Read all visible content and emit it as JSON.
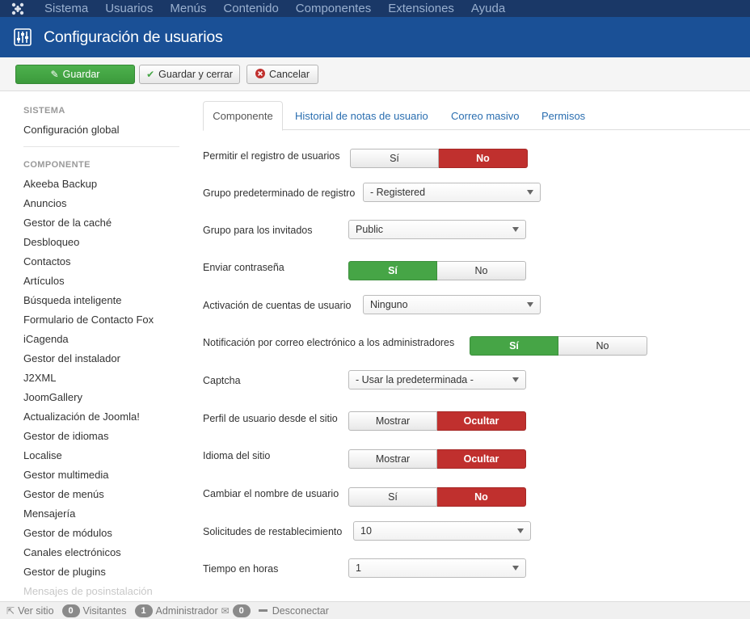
{
  "topnav": {
    "logo_icon": "joomla-logo-icon",
    "items": [
      "Sistema",
      "Usuarios",
      "Menús",
      "Contenido",
      "Componentes",
      "Extensiones",
      "Ayuda"
    ]
  },
  "header": {
    "icon": "sliders-icon",
    "title": "Configuración de usuarios"
  },
  "toolbar": {
    "save_label": "Guardar",
    "save_close_label": "Guardar y cerrar",
    "cancel_label": "Cancelar"
  },
  "sidebar": {
    "system_heading": "SISTEMA",
    "global_config": "Configuración global",
    "component_heading": "COMPONENTE",
    "items": [
      "Akeeba Backup",
      "Anuncios",
      "Gestor de la caché",
      "Desbloqueo",
      "Contactos",
      "Artículos",
      "Búsqueda inteligente",
      "Formulario de Contacto Fox",
      "iCagenda",
      "Gestor del instalador",
      "J2XML",
      "JoomGallery",
      "Actualización de Joomla!",
      "Gestor de idiomas",
      "Localise",
      "Gestor multimedia",
      "Gestor de menús",
      "Mensajería",
      "Gestor de módulos",
      "Canales electrónicos",
      "Gestor de plugins"
    ],
    "faded_item": "Mensajes de posinstalación"
  },
  "tabs": [
    "Componente",
    "Historial de notas de usuario",
    "Correo masivo",
    "Permisos"
  ],
  "form": {
    "allow_registration": {
      "label": "Permitir el registro de usuarios",
      "options": [
        "Sí",
        "No"
      ],
      "selected": "No"
    },
    "default_group": {
      "label": "Grupo predeterminado de registro",
      "value": "- Registered"
    },
    "guest_group": {
      "label": "Grupo para los invitados",
      "value": "Public"
    },
    "send_password": {
      "label": "Enviar contraseña",
      "options": [
        "Sí",
        "No"
      ],
      "selected": "Sí"
    },
    "activation": {
      "label": "Activación de cuentas de usuario",
      "value": "Ninguno"
    },
    "admin_notify": {
      "label": "Notificación por correo electrónico a los administradores",
      "options": [
        "Sí",
        "No"
      ],
      "selected": "Sí"
    },
    "captcha": {
      "label": "Captcha",
      "value": "- Usar la predeterminada -"
    },
    "frontend_profile": {
      "label": "Perfil de usuario desde el sitio",
      "options": [
        "Mostrar",
        "Ocultar"
      ],
      "selected": "Ocultar"
    },
    "site_language": {
      "label": "Idioma del sitio",
      "options": [
        "Mostrar",
        "Ocultar"
      ],
      "selected": "Ocultar"
    },
    "change_username": {
      "label": "Cambiar el nombre de usuario",
      "options": [
        "Sí",
        "No"
      ],
      "selected": "No"
    },
    "reset_requests": {
      "label": "Solicitudes de restablecimiento",
      "value": "10"
    },
    "time_hours": {
      "label": "Tiempo en horas",
      "value": "1"
    }
  },
  "statusbar": {
    "view_site": "Ver sitio",
    "visitors_count": "0",
    "visitors_label": "Visitantes",
    "admin_count": "1",
    "admin_label": "Administrador",
    "messages_count": "0",
    "logout": "Desconectar"
  },
  "colors": {
    "topnav_bg": "#1a3867",
    "header_bg": "#1a5096",
    "save_green": "#46a546",
    "toggle_red": "#c0302e",
    "link_blue": "#2a6eb0"
  }
}
